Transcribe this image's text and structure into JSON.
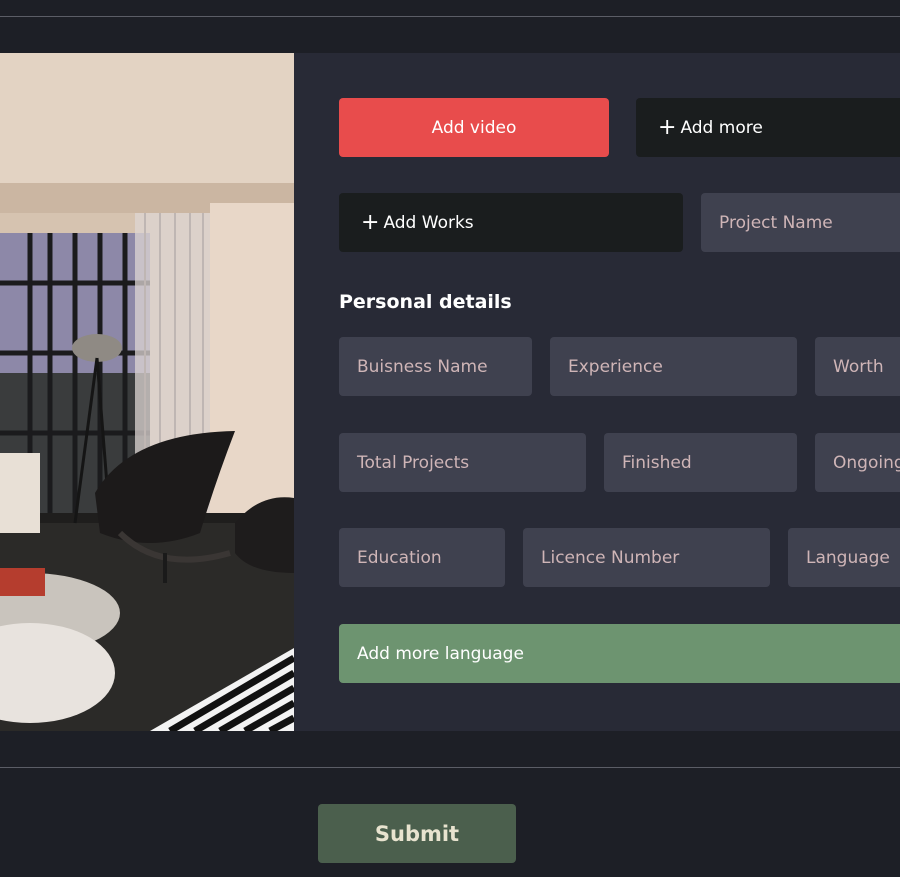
{
  "media": {
    "add_video_label": "Add video",
    "add_more_label": "Add more",
    "add_works_label": "Add Works",
    "project_name_placeholder": "Project Name",
    "plus_glyph": "+"
  },
  "personal_details": {
    "title": "Personal details",
    "fields": {
      "business_name": "Buisness Name",
      "experience": "Experience",
      "worth": "Worth",
      "total_projects": "Total Projects",
      "finished": "Finished",
      "ongoing": "Ongoing",
      "education": "Education",
      "licence_number": "Licence Number",
      "language": "Language"
    },
    "add_more_language_label": "Add more language"
  },
  "submit_label": "Submit",
  "colors": {
    "page_bg": "#1d1f26",
    "panel_bg": "#282a36",
    "accent_red": "#e84c4c",
    "dark_button": "#1a1d1e",
    "field_bg": "#3f414f",
    "field_text": "#cfb5b7",
    "green_button": "#6d9470",
    "submit_bg": "#4b5f4d"
  }
}
